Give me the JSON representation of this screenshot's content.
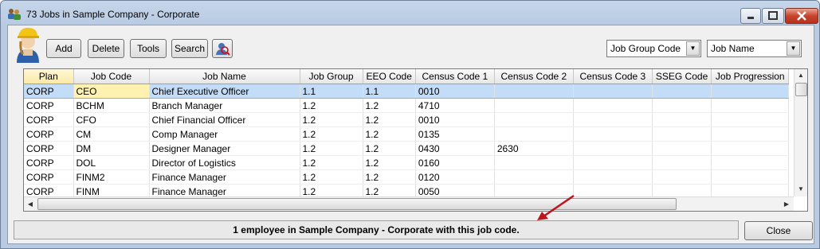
{
  "window": {
    "title": "73 Jobs in Sample Company - Corporate"
  },
  "toolbar": {
    "add_label": "Add",
    "delete_label": "Delete",
    "tools_label": "Tools",
    "search_label": "Search",
    "group_combo_value": "Job Group Code",
    "name_combo_value": "Job Name"
  },
  "table": {
    "columns": [
      "Plan",
      "Job Code",
      "Job Name",
      "Job Group",
      "EEO Code",
      "Census Code 1",
      "Census Code 2",
      "Census Code 3",
      "SSEG Code",
      "Job Progression"
    ],
    "rows": [
      [
        "CORP",
        "CEO",
        "Chief Executive Officer",
        "1.1",
        "1.1",
        "0010",
        "",
        "",
        "",
        ""
      ],
      [
        "CORP",
        "BCHM",
        "Branch Manager",
        "1.2",
        "1.2",
        "4710",
        "",
        "",
        "",
        ""
      ],
      [
        "CORP",
        "CFO",
        "Chief Financial Officer",
        "1.2",
        "1.2",
        "0010",
        "",
        "",
        "",
        ""
      ],
      [
        "CORP",
        "CM",
        "Comp Manager",
        "1.2",
        "1.2",
        "0135",
        "",
        "",
        "",
        ""
      ],
      [
        "CORP",
        "DM",
        "Designer Manager",
        "1.2",
        "1.2",
        "0430",
        "2630",
        "",
        "",
        ""
      ],
      [
        "CORP",
        "DOL",
        "Director of Logistics",
        "1.2",
        "1.2",
        "0160",
        "",
        "",
        "",
        ""
      ],
      [
        "CORP",
        "FINM2",
        "Finance Manager",
        "1.2",
        "1.2",
        "0120",
        "",
        "",
        "",
        ""
      ],
      [
        "CORP",
        "FINM",
        "Finance Manager",
        "1.2",
        "1.2",
        "0050",
        "",
        "",
        "",
        ""
      ]
    ]
  },
  "status": {
    "message": "1 employee in Sample Company - Corporate with this job code."
  },
  "footer": {
    "close_label": "Close"
  },
  "colors": {
    "selected_row": "#c3dcf7",
    "selected_cell": "#fff2b0",
    "annotation_arrow": "#c0141a"
  }
}
